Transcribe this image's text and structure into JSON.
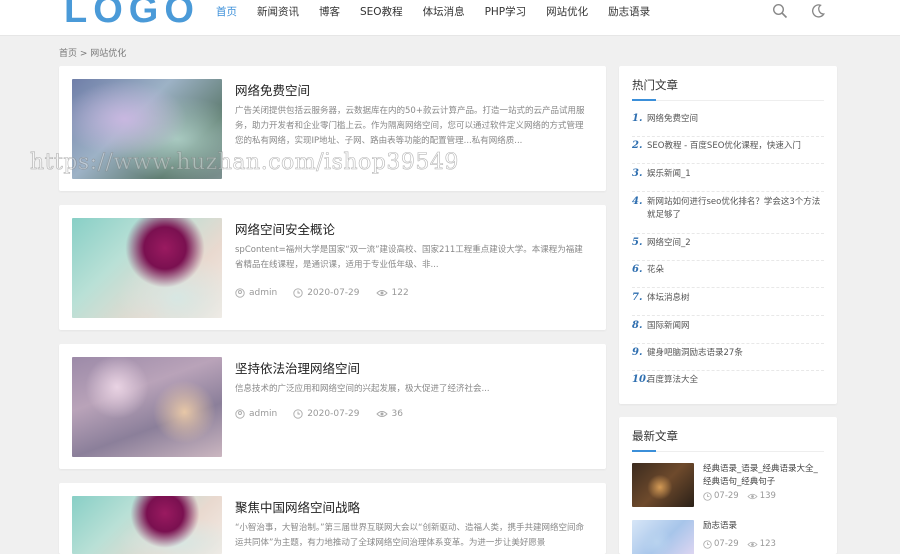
{
  "header": {
    "logo": "LOGO",
    "nav": [
      "首页",
      "新闻资讯",
      "博客",
      "SEO教程",
      "体坛消息",
      "PHP学习",
      "网站优化",
      "励志语录"
    ],
    "active_index": 0,
    "icons": [
      "search-icon",
      "moon-icon"
    ],
    "accent": "#3b8fd9"
  },
  "breadcrumb": "首页 > 网站优化",
  "posts": [
    {
      "title": "网络免费空间",
      "excerpt": "广告关闭提供包括云服务器，云数据库在内的50+款云计算产品。打造一站式的云产品试用服务，助力开发者和企业零门槛上云。作为隔离网络空间，您可以通过软件定义网络的方式管理您的私有网络，实现IP地址、子网、路由表等功能的配置管理...私有网络质..."
    },
    {
      "title": "网络空间安全概论",
      "excerpt": "spContent=福州大学是国家“双一流”建设高校、国家211工程重点建设大学。本课程为福建省精品在线课程，是通识课，适用于专业低年级、非...",
      "author": "admin",
      "date": "2020-07-29",
      "views": "122"
    },
    {
      "title": "坚持依法治理网络空间",
      "excerpt": "信息技术的广泛应用和网络空间的兴起发展，极大促进了经济社会...",
      "author": "admin",
      "date": "2020-07-29",
      "views": "36"
    },
    {
      "title": "聚焦中国网络空间战略",
      "excerpt": "“小智治事，大智治制。”第三届世界互联网大会以“创新驱动、造福人类，携手共建网络空间命运共同体”为主题，有力地推动了全球网络空间治理体系变革。为进一步让美好愿景"
    }
  ],
  "hot": {
    "title": "热门文章",
    "items": [
      {
        "num": "1.",
        "label": "网络免费空间"
      },
      {
        "num": "2.",
        "label": "SEO教程 - 百度SEO优化课程，快速入门"
      },
      {
        "num": "3.",
        "label": "娱乐新闻_1"
      },
      {
        "num": "4.",
        "label": "新网站如何进行seo优化排名？学会这3个方法就足够了"
      },
      {
        "num": "5.",
        "label": "网络空间_2"
      },
      {
        "num": "6.",
        "label": "花朵"
      },
      {
        "num": "7.",
        "label": "体坛消息树"
      },
      {
        "num": "8.",
        "label": "国际新闻网"
      },
      {
        "num": "9.",
        "label": "健身吧脑洞励志语录27条"
      },
      {
        "num": "10.",
        "label": "百度算法大全"
      }
    ]
  },
  "latest": {
    "title": "最新文章",
    "items": [
      {
        "title": "经典语录_语录_经典语录大全_经典语句_经典句子",
        "date": "07-29",
        "views": "139"
      },
      {
        "title": "励志语录",
        "date": "07-29",
        "views": "123"
      }
    ]
  },
  "watermark": "https://www.huzhan.com/ishop39549"
}
